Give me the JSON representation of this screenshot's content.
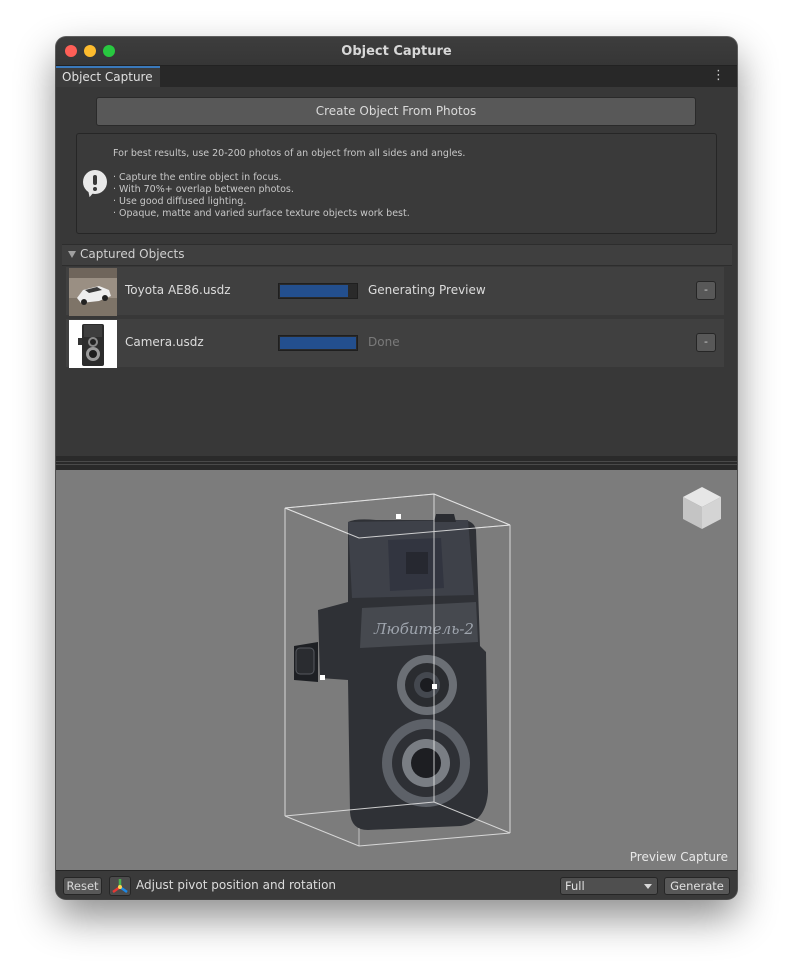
{
  "window": {
    "title": "Object Capture"
  },
  "tabs": [
    {
      "label": "Object Capture"
    }
  ],
  "tab_menu_icon": "vertical-ellipsis-icon",
  "create_button": {
    "label": "Create Object From Photos"
  },
  "help": {
    "icon": "speech-bubble-exclamation-icon",
    "intro": "For best results, use 20-200 photos of an object from all sides and angles.",
    "tips": [
      "· Capture the entire object in focus.",
      "· With 70%+ overlap between photos.",
      "· Use good diffused lighting.",
      "· Opaque, matte and varied surface texture objects work best."
    ]
  },
  "captured": {
    "title": "Captured Objects",
    "items": [
      {
        "name": "Toyota AE86.usdz",
        "progress": 0.9,
        "status": "Generating",
        "status_color": "#dcdcdc",
        "preview_label": "Preview",
        "remove_label": "-"
      },
      {
        "name": "Camera.usdz",
        "progress": 1.0,
        "status": "Done",
        "status_color": "#7a7a7a",
        "preview_label": "",
        "remove_label": "-"
      }
    ]
  },
  "viewport": {
    "label": "Preview Capture",
    "orientation_icon": "cube-gizmo-icon",
    "model_text": "Любитель-2"
  },
  "bottom": {
    "reset_label": "Reset",
    "pivot_icon": "pivot-gizmo-icon",
    "pivot_label": "Adjust pivot position and rotation",
    "quality_value": "Full",
    "generate_label": "Generate"
  },
  "colors": {
    "accent": "#3a79bb",
    "progress_fill": "#234f8e",
    "viewport_bg": "#7c7c7c"
  }
}
